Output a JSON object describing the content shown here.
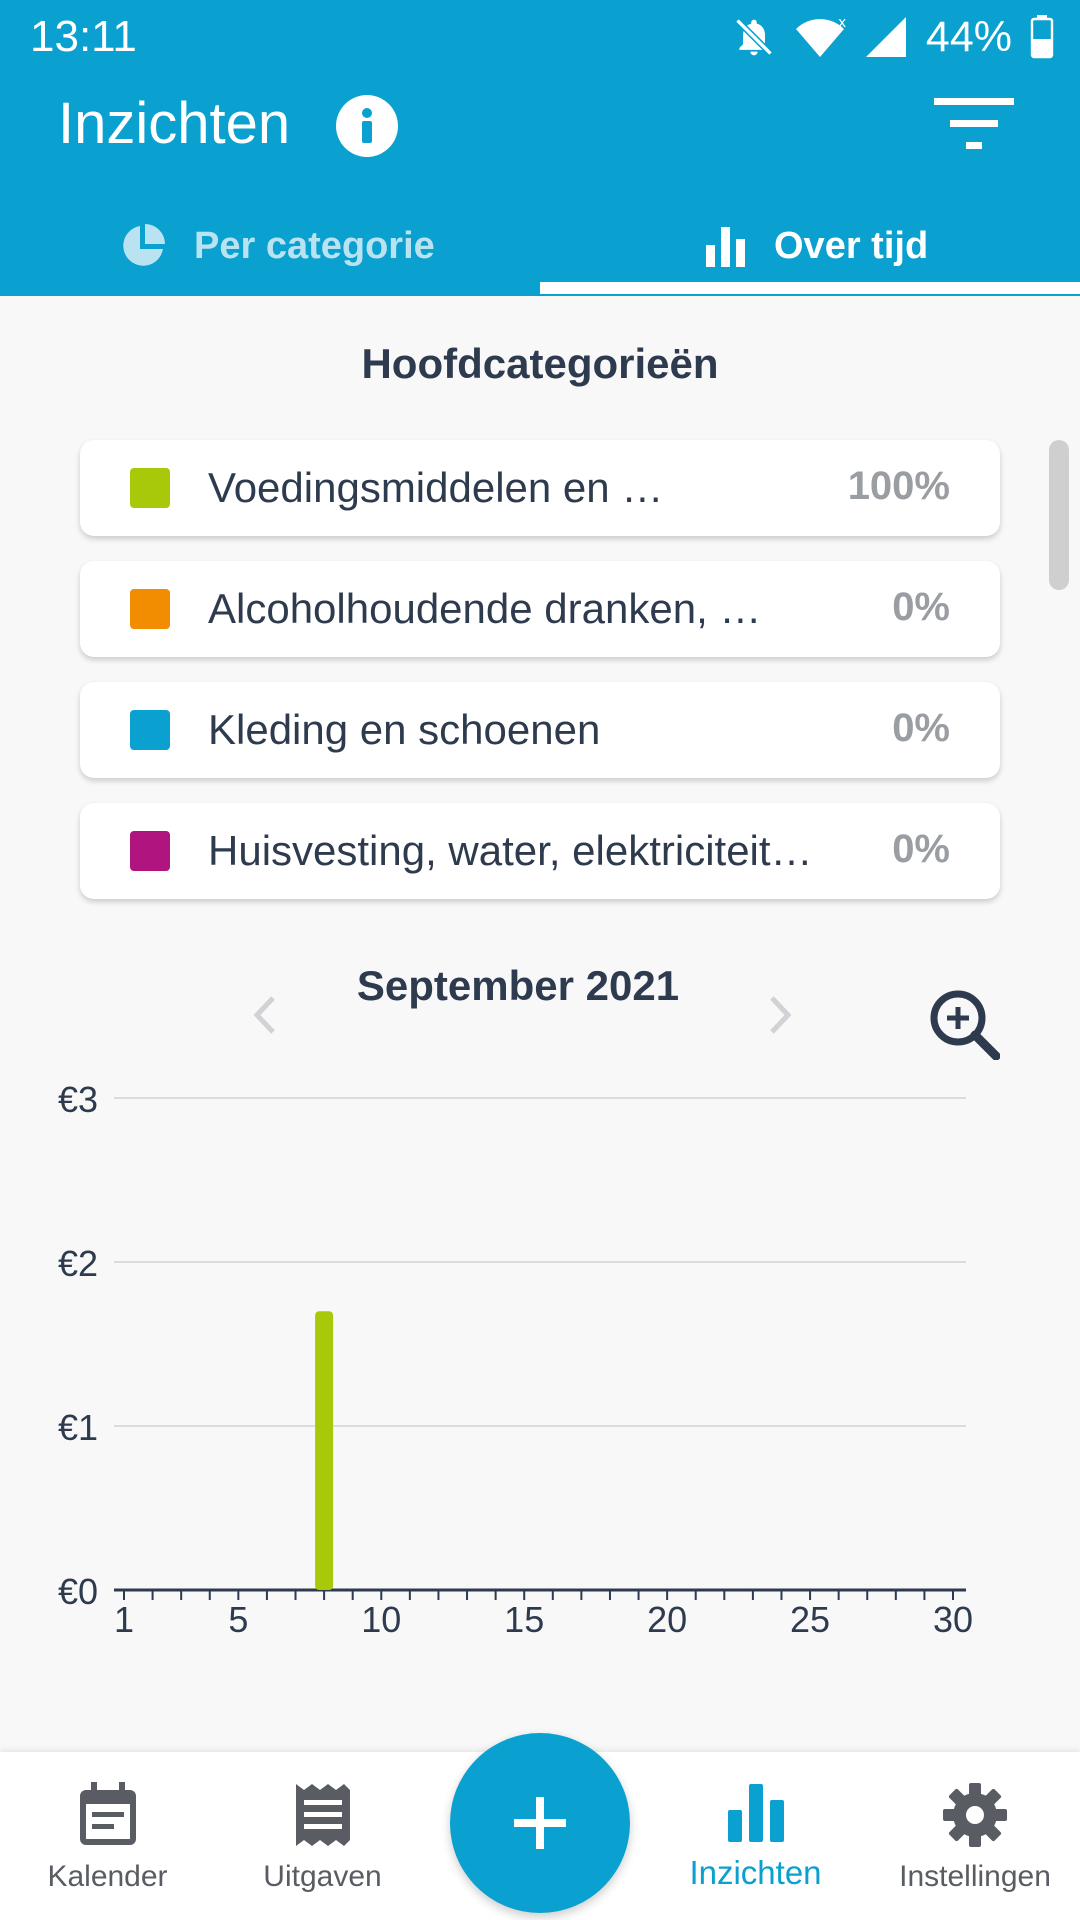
{
  "status_bar": {
    "time": "13:11",
    "battery": "44%"
  },
  "header": {
    "title": "Inzichten"
  },
  "tabs": [
    {
      "label": "Per categorie",
      "active": false
    },
    {
      "label": "Over tijd",
      "active": true
    }
  ],
  "section_title": "Hoofdcategorieën",
  "categories": [
    {
      "name": "Voedingsmiddelen en …",
      "percent": "100%",
      "color": "#a8c90a"
    },
    {
      "name": "Alcoholhoudende dranken, …",
      "percent": "0%",
      "color": "#f28c00"
    },
    {
      "name": "Kleding en schoenen",
      "percent": "0%",
      "color": "#0aa0cf"
    },
    {
      "name": "Huisvesting, water, elektriciteit…",
      "percent": "0%",
      "color": "#b0147f"
    }
  ],
  "period": {
    "label": "September 2021"
  },
  "chart_data": {
    "type": "bar",
    "title": "",
    "xlabel": "",
    "ylabel": "",
    "x_ticks": [
      1,
      5,
      10,
      15,
      20,
      25,
      30
    ],
    "y_ticks": [
      "€0",
      "€1",
      "€2",
      "€3"
    ],
    "xlim": [
      1,
      30
    ],
    "ylim": [
      0,
      3
    ],
    "grid": true,
    "series": [
      {
        "color": "#a8c90a",
        "points": [
          {
            "x": 8,
            "y": 1.7
          }
        ]
      }
    ]
  },
  "nav": {
    "items": [
      {
        "label": "Kalender",
        "icon": "calendar-icon",
        "active": false
      },
      {
        "label": "Uitgaven",
        "icon": "receipt-icon",
        "active": false
      },
      {
        "label": "Inzichten",
        "icon": "bar-chart-icon",
        "active": true
      },
      {
        "label": "Instellingen",
        "icon": "gear-icon",
        "active": false
      }
    ],
    "fab_icon": "plus-icon"
  },
  "colors": {
    "primary": "#0aa0cf",
    "text_dark": "#2e3b4e",
    "text_muted": "#9a9ea3"
  }
}
